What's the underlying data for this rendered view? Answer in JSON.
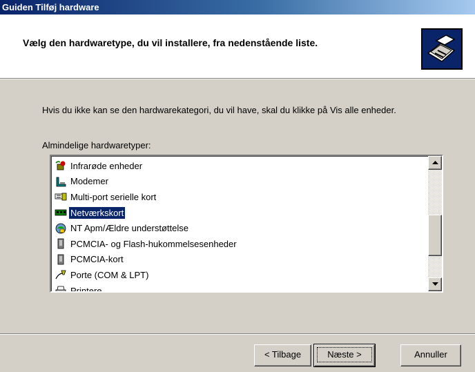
{
  "window": {
    "title": "Guiden Tilføj hardware"
  },
  "header": {
    "title": "Vælg den hardwaretype, du vil installere, fra nedenstående liste."
  },
  "body": {
    "info_text": "Hvis du ikke kan se den hardwarekategori, du vil have, skal du klikke på Vis alle enheder.",
    "list_label": "Almindelige hardwaretyper:"
  },
  "list": {
    "items": [
      {
        "label": "Infrarøde enheder",
        "icon": "infrared-icon"
      },
      {
        "label": "Modemer",
        "icon": "modem-icon"
      },
      {
        "label": "Multi-port serielle kort",
        "icon": "multiport-serial-icon"
      },
      {
        "label": "Netværkskort",
        "icon": "network-card-icon",
        "selected": true
      },
      {
        "label": "NT Apm/Ældre understøttelse",
        "icon": "apm-icon"
      },
      {
        "label": "PCMCIA- og Flash-hukommelsesenheder",
        "icon": "pcmcia-icon"
      },
      {
        "label": "PCMCIA-kort",
        "icon": "pcmcia-icon"
      },
      {
        "label": "Porte (COM & LPT)",
        "icon": "port-icon"
      },
      {
        "label": "Printere",
        "icon": "printer-icon"
      }
    ]
  },
  "buttons": {
    "back": "< Tilbage",
    "next": "Næste >",
    "cancel": "Annuller"
  },
  "colors": {
    "selection": "#0a246a",
    "dialog": "#d4d0c8"
  }
}
